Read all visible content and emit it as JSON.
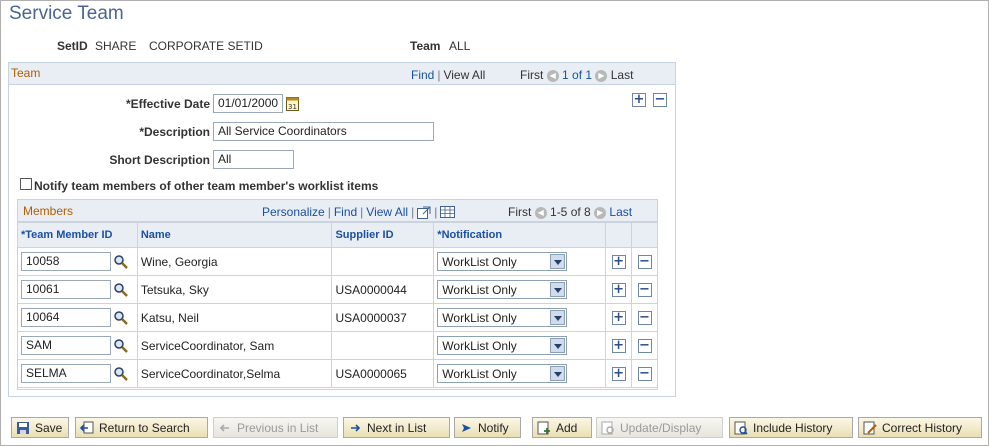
{
  "page": {
    "title": "Service Team"
  },
  "header": {
    "setid_label": "SetID",
    "setid_value": "SHARE",
    "setid_desc": "CORPORATE SETID",
    "team_label": "Team",
    "team_value": "ALL"
  },
  "team_box": {
    "caption": "Team",
    "find": "Find",
    "view_all": "View All",
    "first": "First",
    "count": "1 of 1",
    "last": "Last",
    "effective_date_label": "Effective Date",
    "effective_date_value": "01/01/2000",
    "description_label": "Description",
    "description_value": "All Service Coordinators",
    "short_desc_label": "Short Description",
    "short_desc_value": "All",
    "notify_label": "Notify team members of other team member's worklist items",
    "required_mark": "*"
  },
  "members": {
    "caption": "Members",
    "personalize": "Personalize",
    "find": "Find",
    "view_all": "View All",
    "first": "First",
    "count": "1-5 of 8",
    "last": "Last",
    "columns": [
      "Team Member ID",
      "Name",
      "Supplier ID",
      "Notification"
    ],
    "rows": [
      {
        "id": "10058",
        "name": "Wine, Georgia",
        "supplier": "",
        "notification": "WorkList Only"
      },
      {
        "id": "10061",
        "name": "Tetsuka, Sky",
        "supplier": "USA0000044",
        "notification": "WorkList Only"
      },
      {
        "id": "10064",
        "name": "Katsu, Neil",
        "supplier": "USA0000037",
        "notification": "WorkList Only"
      },
      {
        "id": "SAM",
        "name": "ServiceCoordinator, Sam",
        "supplier": "",
        "notification": "WorkList Only"
      },
      {
        "id": "SELMA",
        "name": "ServiceCoordinator,Selma",
        "supplier": "USA0000065",
        "notification": "WorkList Only"
      }
    ]
  },
  "toolbar": {
    "save": "Save",
    "return_to_search": "Return to Search",
    "previous_in_list": "Previous in List",
    "next_in_list": "Next in List",
    "notify": "Notify",
    "add": "Add",
    "update_display": "Update/Display",
    "include_history": "Include History",
    "correct_history": "Correct History"
  },
  "colors": {
    "title": "#4a6592",
    "link": "#1a4fa3",
    "caption": "#b35c00",
    "bar_bg": "#e9eef5"
  }
}
